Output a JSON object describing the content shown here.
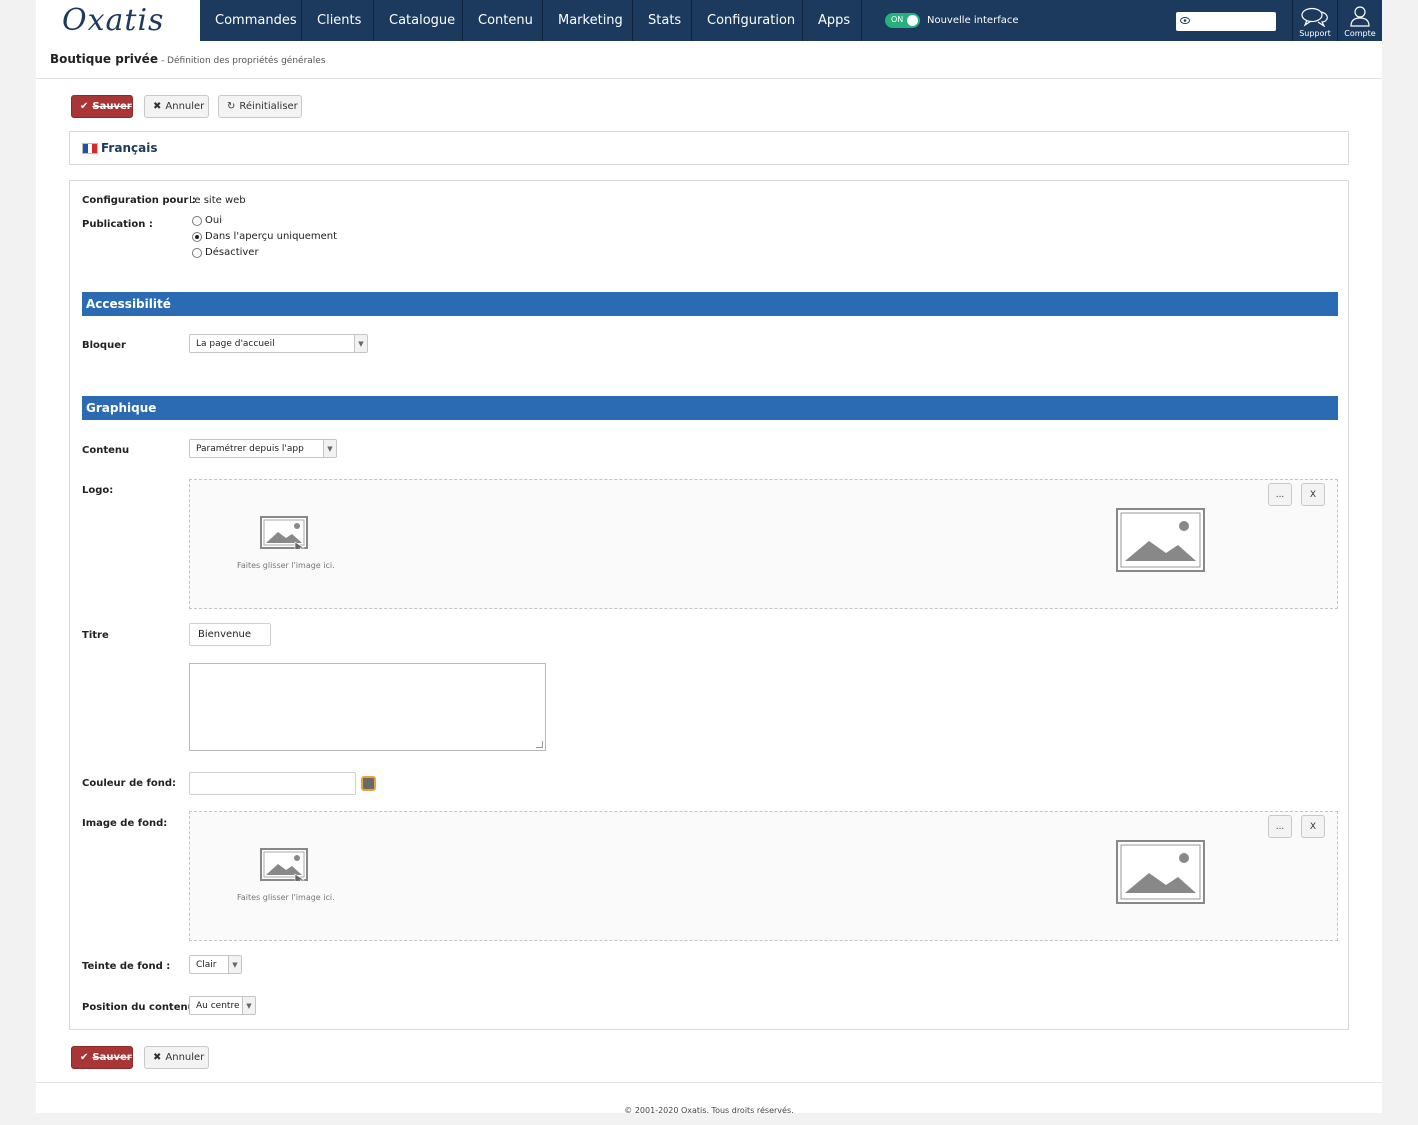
{
  "app": {
    "logo_text": "Oxatis",
    "nav": [
      "Commandes",
      "Clients",
      "Catalogue",
      "Contenu",
      "Marketing",
      "Stats",
      "Configuration",
      "Apps"
    ],
    "toggle": {
      "state_label": "ON",
      "label": "Nouvelle interface"
    },
    "support_label": "Support",
    "account_label": "Compte"
  },
  "header": {
    "title": "Boutique privée",
    "subtitle": "- Définition des propriétés générales"
  },
  "toolbar": {
    "save_label": "Sauver",
    "cancel_label": "Annuler",
    "reset_label": "Réinitialiser"
  },
  "language": {
    "label": "Français",
    "flag_colors": [
      "#1f4fa8",
      "#ffffff",
      "#d62b2b"
    ]
  },
  "form": {
    "config_label": "Configuration pour :",
    "config_value": "Le site web",
    "publication_label": "Publication :",
    "publication_options": [
      {
        "label": "Oui",
        "checked": false
      },
      {
        "label": "Dans l'aperçu uniquement",
        "checked": true
      },
      {
        "label": "Désactiver",
        "checked": false
      }
    ],
    "accessibility_title": "Accessibilité",
    "block_label": "Bloquer",
    "block_value": "La page d'accueil",
    "graphics_title": "Graphique",
    "content_label": "Contenu",
    "content_value": "Paramétrer depuis l'app",
    "logo_label": "Logo:",
    "drop_text": "Faites glisser l'image ici.",
    "browse_label": "...",
    "clear_label": "X",
    "title_label": "Titre",
    "title_value": "Bienvenue",
    "bgcolor_label": "Couleur de fond:",
    "bgcolor_value": "",
    "bgimage_label": "Image de fond:",
    "tint_label": "Teinte de fond :",
    "tint_value": "Clair",
    "position_label": "Position du contenu:",
    "position_value": "Au centre"
  },
  "colors": {
    "nav_bg": "#1c3a5e",
    "section_bar": "#2a6bb3",
    "save_button": "#a83636",
    "toggle_on": "#26b07b",
    "swatch": "#6a6a6a"
  },
  "footer": {
    "copyright": "© 2001-2020 Oxatis. Tous droits réservés."
  }
}
